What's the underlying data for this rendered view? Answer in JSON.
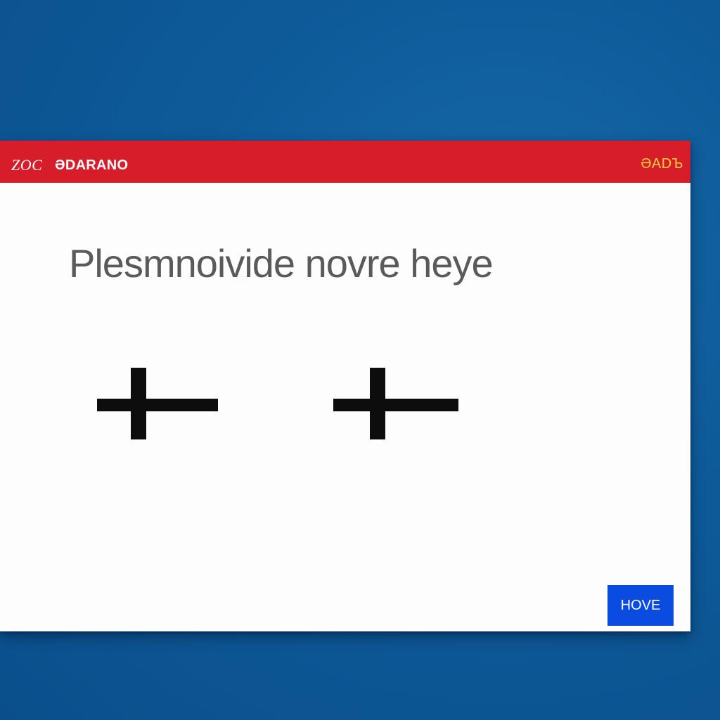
{
  "window": {
    "app_name": "ZOC",
    "title": "ƏDARANO",
    "corner_label": "ƏADЪ"
  },
  "content": {
    "message": "Plesmnoivide novre heye"
  },
  "icons": {
    "left": "plus-icon",
    "right": "plus-icon"
  },
  "button": {
    "label": "HOVE"
  },
  "colors": {
    "desktop": "#0e5a99",
    "titlebar": "#d81d2a",
    "corner_label": "#f4d03f",
    "button": "#0a4ce0",
    "message_text": "#5a5a5a"
  }
}
